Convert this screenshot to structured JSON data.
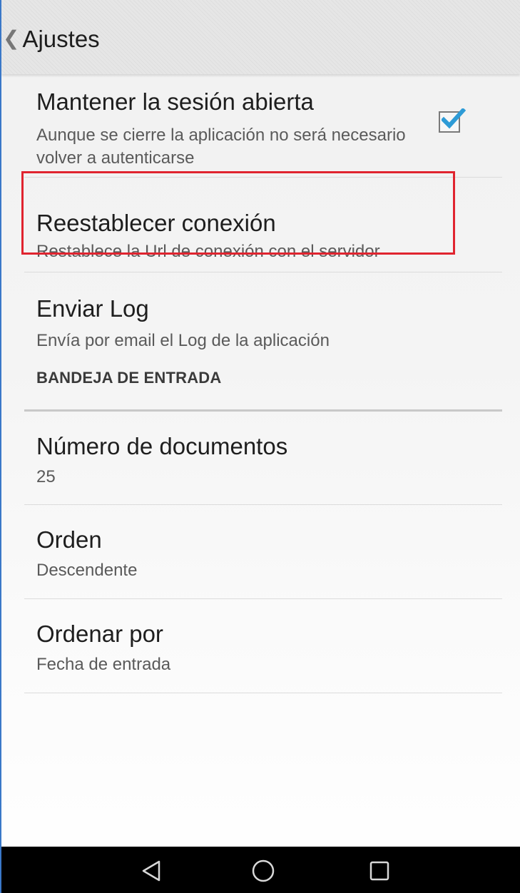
{
  "action_bar": {
    "title": "Ajustes",
    "back_icon": "chevron-left-icon"
  },
  "preferences": [
    {
      "title": "Mantener la sesión abierta",
      "summary": "Aunque se cierre la aplicación no será necesario volver a autenticarse",
      "checked": true
    },
    {
      "title": "Reestablecer conexión",
      "summary": "Restablece la Url de conexión con el servidor",
      "highlighted": true
    },
    {
      "title": "Enviar Log",
      "summary": "Envía por email el Log de la aplicación"
    }
  ],
  "inbox_section": {
    "header": "BANDEJA DE ENTRADA",
    "items": [
      {
        "title": "Número de documentos",
        "summary": "25"
      },
      {
        "title": "Orden",
        "summary": "Descendente"
      },
      {
        "title": "Ordenar por",
        "summary": "Fecha de entrada"
      }
    ]
  },
  "nav_bar": {
    "back_icon": "triangle-back-icon",
    "home_icon": "circle-home-icon",
    "recents_icon": "square-recents-icon"
  },
  "colors": {
    "checkbox_check": "#2e9bd6",
    "highlight_border": "#e0242f",
    "nav_bar_background": "#000000"
  }
}
